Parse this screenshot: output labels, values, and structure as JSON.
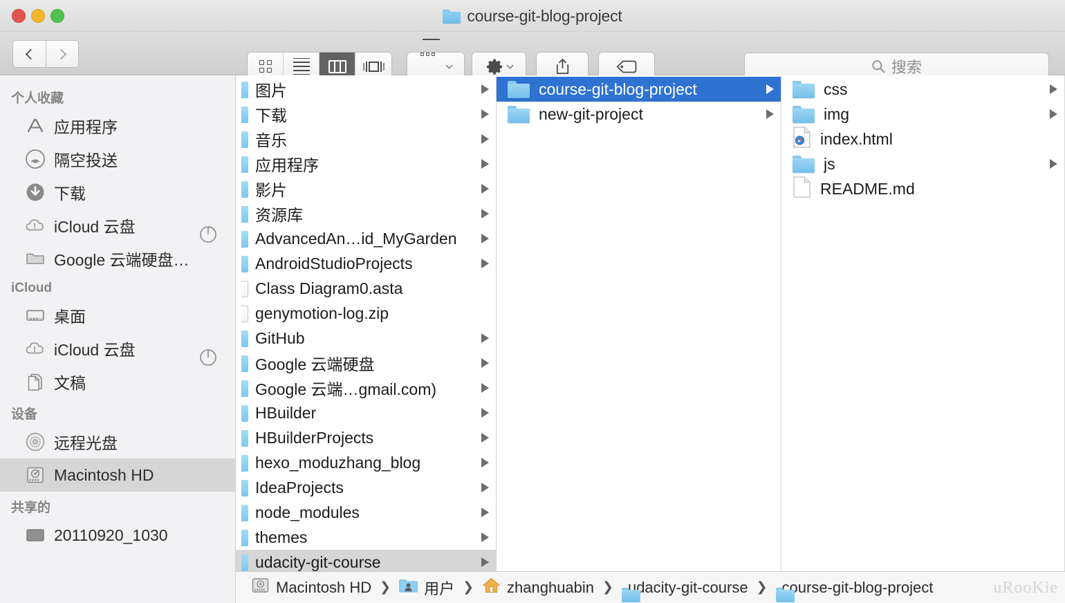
{
  "window": {
    "title": "course-git-blog-project",
    "traffic_lights": [
      "close",
      "minimize",
      "maximize"
    ]
  },
  "toolbar": {
    "back_label": "Back",
    "forward_label": "Forward",
    "view_modes": [
      {
        "name": "icon-view",
        "active": false
      },
      {
        "name": "list-view",
        "active": false
      },
      {
        "name": "column-view",
        "active": true
      },
      {
        "name": "gallery-view",
        "active": false
      }
    ],
    "arrange_label": "Arrange",
    "action_label": "Action",
    "share_label": "Share",
    "tags_label": "Tags"
  },
  "search": {
    "placeholder": "搜索",
    "value": ""
  },
  "sidebar": {
    "sections": [
      {
        "header": "个人收藏",
        "items": [
          {
            "label": "应用程序",
            "icon": "applications-icon",
            "selected": false,
            "spinner": false
          },
          {
            "label": "隔空投送",
            "icon": "airdrop-icon",
            "selected": false,
            "spinner": false
          },
          {
            "label": "下载",
            "icon": "downloads-icon",
            "selected": false,
            "spinner": false
          },
          {
            "label": "iCloud 云盘",
            "icon": "icloud-alert-icon",
            "selected": false,
            "spinner": true
          },
          {
            "label": "Google 云端硬盘…",
            "icon": "folder-gray-icon",
            "selected": false,
            "spinner": false
          }
        ]
      },
      {
        "header": "iCloud",
        "items": [
          {
            "label": "桌面",
            "icon": "desktop-icon",
            "selected": false,
            "spinner": false
          },
          {
            "label": "iCloud 云盘",
            "icon": "icloud-alert-icon",
            "selected": false,
            "spinner": true
          },
          {
            "label": "文稿",
            "icon": "documents-icon",
            "selected": false,
            "spinner": false
          }
        ]
      },
      {
        "header": "设备",
        "items": [
          {
            "label": "远程光盘",
            "icon": "optical-disc-icon",
            "selected": false,
            "spinner": false
          },
          {
            "label": "Macintosh HD",
            "icon": "hard-drive-icon",
            "selected": true,
            "spinner": false
          }
        ]
      },
      {
        "header": "共享的",
        "items": [
          {
            "label": "20110920_1030",
            "icon": "display-icon",
            "selected": false,
            "spinner": false
          }
        ]
      }
    ]
  },
  "columns": [
    {
      "name": "column-home",
      "items": [
        {
          "label": "图片",
          "type": "folder",
          "disclosure": true,
          "state": "none"
        },
        {
          "label": "下载",
          "type": "folder",
          "disclosure": true,
          "state": "none"
        },
        {
          "label": "音乐",
          "type": "folder",
          "disclosure": true,
          "state": "none"
        },
        {
          "label": "应用程序",
          "type": "folder",
          "disclosure": true,
          "state": "none"
        },
        {
          "label": "影片",
          "type": "folder",
          "disclosure": true,
          "state": "none"
        },
        {
          "label": "资源库",
          "type": "folder",
          "disclosure": true,
          "state": "none"
        },
        {
          "label": "AdvancedAn…id_MyGarden",
          "type": "folder",
          "disclosure": true,
          "state": "none"
        },
        {
          "label": "AndroidStudioProjects",
          "type": "folder",
          "disclosure": true,
          "state": "none"
        },
        {
          "label": "Class Diagram0.asta",
          "type": "file",
          "disclosure": false,
          "state": "none"
        },
        {
          "label": "genymotion-log.zip",
          "type": "file",
          "disclosure": false,
          "state": "none"
        },
        {
          "label": "GitHub",
          "type": "folder",
          "disclosure": true,
          "state": "none"
        },
        {
          "label": "Google 云端硬盘",
          "type": "folder",
          "disclosure": true,
          "state": "none"
        },
        {
          "label": "Google 云端…gmail.com)",
          "type": "folder",
          "disclosure": true,
          "state": "none"
        },
        {
          "label": "HBuilder",
          "type": "folder",
          "disclosure": true,
          "state": "none"
        },
        {
          "label": "HBuilderProjects",
          "type": "folder",
          "disclosure": true,
          "state": "none"
        },
        {
          "label": "hexo_moduzhang_blog",
          "type": "folder",
          "disclosure": true,
          "state": "none"
        },
        {
          "label": "IdeaProjects",
          "type": "folder",
          "disclosure": true,
          "state": "none"
        },
        {
          "label": "node_modules",
          "type": "folder",
          "disclosure": true,
          "state": "none"
        },
        {
          "label": "themes",
          "type": "folder",
          "disclosure": true,
          "state": "none"
        },
        {
          "label": "udacity-git-course",
          "type": "folder",
          "disclosure": true,
          "state": "selected-inactive"
        }
      ]
    },
    {
      "name": "column-udacity-git-course",
      "items": [
        {
          "label": "course-git-blog-project",
          "type": "folder",
          "disclosure": true,
          "state": "selected-active"
        },
        {
          "label": "new-git-project",
          "type": "folder",
          "disclosure": true,
          "state": "none"
        }
      ]
    },
    {
      "name": "column-course-git-blog-project",
      "items": [
        {
          "label": "css",
          "type": "folder",
          "disclosure": true,
          "state": "none"
        },
        {
          "label": "img",
          "type": "folder",
          "disclosure": true,
          "state": "none"
        },
        {
          "label": "index.html",
          "type": "html-file",
          "disclosure": false,
          "state": "none"
        },
        {
          "label": "js",
          "type": "folder",
          "disclosure": true,
          "state": "none"
        },
        {
          "label": "README.md",
          "type": "file",
          "disclosure": false,
          "state": "none"
        }
      ]
    }
  ],
  "pathbar": {
    "segments": [
      {
        "label": "Macintosh HD",
        "icon": "hard-drive-icon"
      },
      {
        "label": "用户",
        "icon": "users-folder-icon"
      },
      {
        "label": "zhanghuabin",
        "icon": "home-folder-icon"
      },
      {
        "label": "udacity-git-course",
        "icon": "folder-icon"
      },
      {
        "label": "course-git-blog-project",
        "icon": "folder-icon"
      }
    ],
    "separator": "❯"
  },
  "watermark": "uRooKie",
  "colors": {
    "selection_active": "#2e72d2",
    "selection_inactive": "#d6d6d6",
    "folder_blue": "#7ec7ee",
    "sidebar_bg": "#f2f2f4"
  }
}
